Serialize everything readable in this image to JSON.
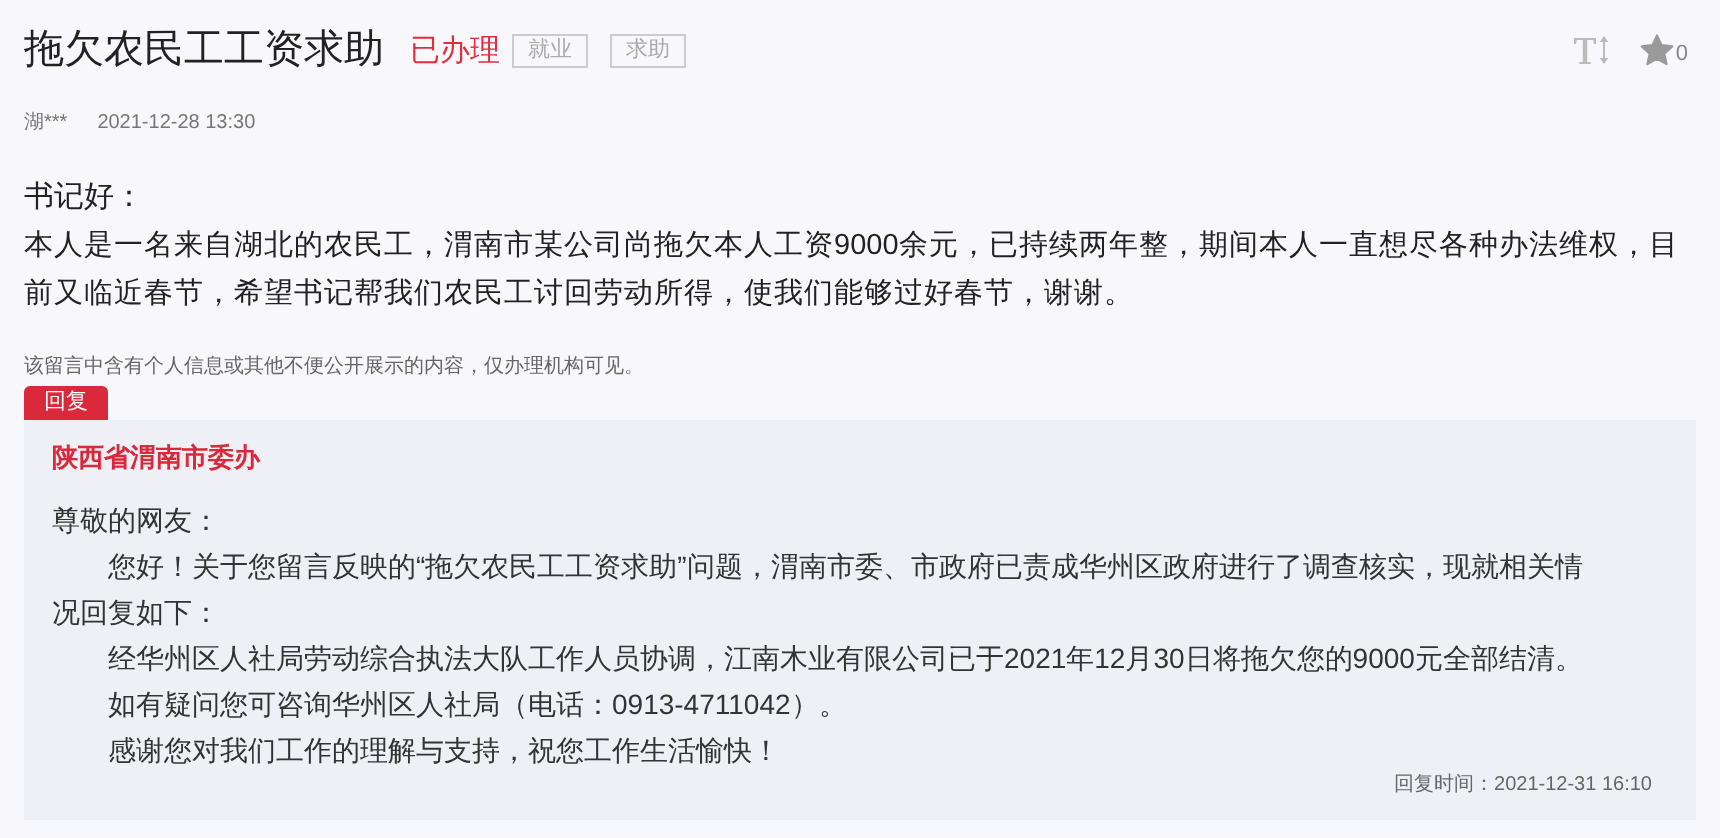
{
  "title": "拖欠农民工工资求助",
  "status": "已办理",
  "tags": [
    "就业",
    "求助"
  ],
  "favorite_count": "0",
  "author": "湖***",
  "time": "2021-12-28 13:30",
  "message": {
    "greeting": "书记好：",
    "body": "本人是一名来自湖北的农民工，渭南市某公司尚拖欠本人工资9000余元，已持续两年整，期间本人一直想尽各种办法维权，目前又临近春节，希望书记帮我们农民工讨回劳动所得，使我们能够过好春节，谢谢。"
  },
  "privacy_note": "该留言中含有个人信息或其他不便公开展示的内容，仅办理机构可见。",
  "reply": {
    "label": "回复",
    "organization": "陕西省渭南市委办",
    "salutation": "尊敬的网友：",
    "paragraphs": [
      "您好！关于您留言反映的“拖欠农民工工资求助”问题，渭南市委、市政府已责成华州区政府进行了调查核实，现就相关情况回复如下：",
      "经华州区人社局劳动综合执法大队工作人员协调，江南木业有限公司已于2021年12月30日将拖欠您的9000元全部结清。",
      "如有疑问您可咨询华州区人社局（电话：0913-4711042）。",
      "感谢您对我们工作的理解与支持，祝您工作生活愉快！"
    ],
    "time": "回复时间：2021-12-31 16:10"
  }
}
